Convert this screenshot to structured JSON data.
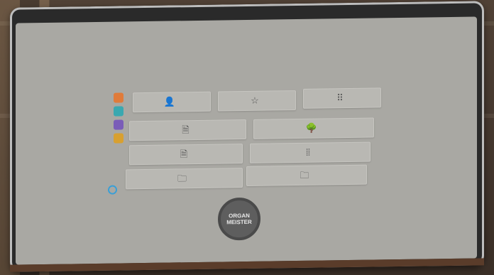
{
  "logo": {
    "line1": "ORGAN",
    "line2": "MEISTER"
  },
  "colors": {
    "screen": "#a9a8a3",
    "tile": "#b9b8b3",
    "power": "#3a9fd6",
    "app1": "#e07b3a",
    "app2": "#3aa8b0",
    "app3": "#7a5db8",
    "app4": "#d8a030"
  },
  "icons": {
    "profile": "user-icon",
    "favorites": "star-icon",
    "combinations": "grid-icon",
    "doc1": "document-icon",
    "doc2": "document-icon",
    "folder1": "folder-icon",
    "tree": "tree-icon",
    "pipes": "pipes-icon",
    "folder2": "folder-icon"
  }
}
